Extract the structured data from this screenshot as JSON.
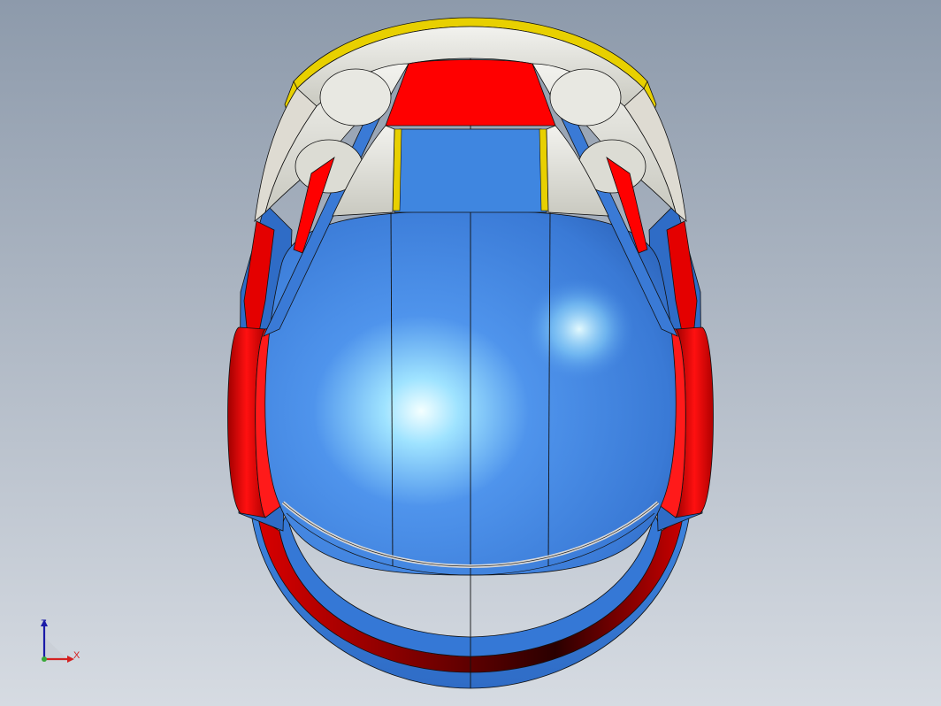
{
  "viewport": {
    "background_top": "#8d9aab",
    "background_bottom": "#d6dbe2"
  },
  "model": {
    "part_colors": {
      "shell_blue": "#3f86e0",
      "shell_blue_dark": "#2457a8",
      "accent_red": "#ff0000",
      "accent_red_dark": "#8a0000",
      "trim_yellow": "#e8d000",
      "panel_white": "#e6e6e0",
      "edge_line": "#111111"
    }
  },
  "triad": {
    "z_label": "Z",
    "x_label": "X",
    "z_color": "#1a1aa8",
    "x_color": "#d42020"
  }
}
